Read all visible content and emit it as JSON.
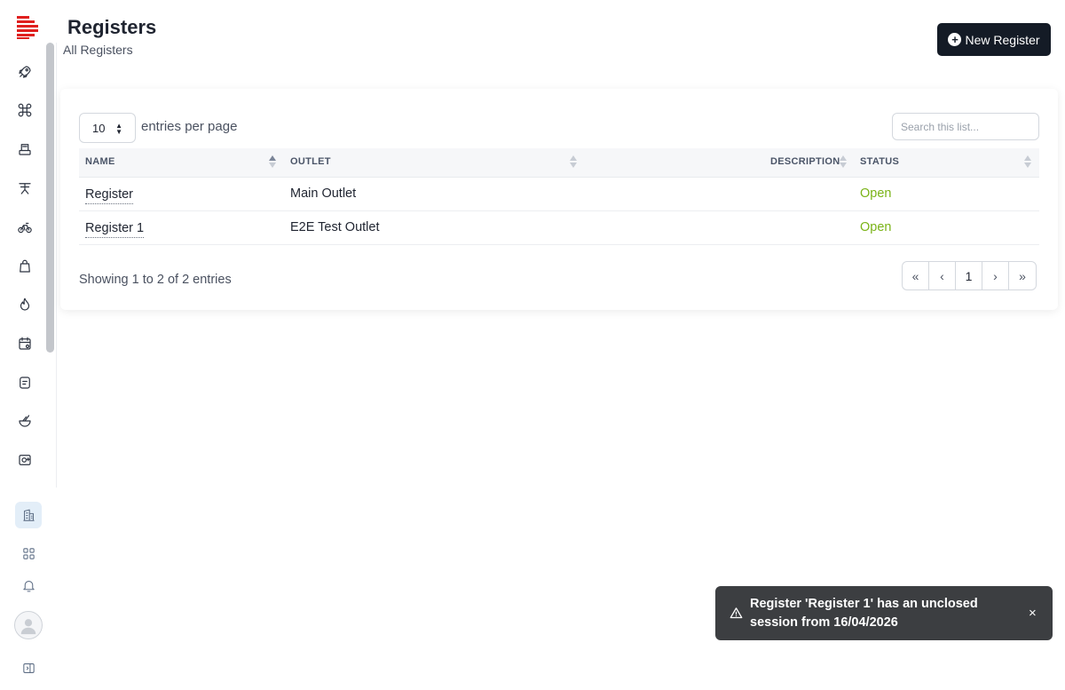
{
  "sidebar": {
    "nav_icons": [
      "rocket-icon",
      "command-icon",
      "register-icon",
      "table-icon",
      "bike-icon",
      "bag-icon",
      "flame-icon",
      "calendar-settings-icon",
      "receipt-icon",
      "bowl-icon",
      "image-plus-icon"
    ],
    "bottom_icons": [
      "building-icon",
      "grid-icon",
      "bell-icon",
      "avatar",
      "sidebar-toggle-icon"
    ],
    "brand_color": "#e0201f"
  },
  "header": {
    "title": "Registers",
    "subtitle": "All Registers",
    "new_button_label": "New Register"
  },
  "controls": {
    "per_page_value": "10",
    "per_page_label": "entries per page",
    "search_placeholder": "Search this list..."
  },
  "table": {
    "columns": [
      "NAME",
      "OUTLET",
      "DESCRIPTION",
      "STATUS"
    ],
    "rows": [
      {
        "name": "Register",
        "outlet": "Main Outlet",
        "description": "",
        "status": "Open"
      },
      {
        "name": "Register 1",
        "outlet": "E2E Test Outlet",
        "description": "",
        "status": "Open"
      }
    ],
    "status_color": "#7ab317"
  },
  "footer": {
    "showing": "Showing 1 to 2 of 2 entries",
    "pager": {
      "first": "«",
      "prev": "‹",
      "current": "1",
      "next": "›",
      "last": "»"
    }
  },
  "toast": {
    "message": "Register 'Register 1' has an unclosed session from 16/04/2026",
    "close": "×"
  }
}
